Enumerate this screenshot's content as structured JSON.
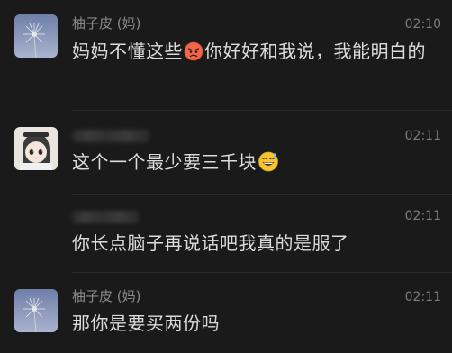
{
  "messages": [
    {
      "sender": "柚子皮 (妈)",
      "time": "02:10",
      "text_before": "妈妈不懂这些",
      "emoji": "angry-face-emoji",
      "text_after": "你好好和我说，我能明白的",
      "avatar": "dandelion-avatar"
    },
    {
      "sender": "",
      "time": "02:11",
      "text_before": "这个一个最少要三千块",
      "emoji": "grinning-sweat-emoji",
      "text_after": "",
      "avatar": "cartoon-girl-avatar"
    },
    {
      "sender": "",
      "time": "02:11",
      "text_before": "你长点脑子再说话吧我真的是服了",
      "emoji": "",
      "text_after": "",
      "avatar": ""
    },
    {
      "sender": "柚子皮 (妈)",
      "time": "02:11",
      "text_before": "那你是要买两份吗",
      "emoji": "",
      "text_after": "",
      "avatar": "dandelion-avatar"
    }
  ],
  "colors": {
    "background": "#1a1a1a",
    "text": "#dcdcdc",
    "meta": "#8a8a8a",
    "divider": "#2b2b2b"
  }
}
